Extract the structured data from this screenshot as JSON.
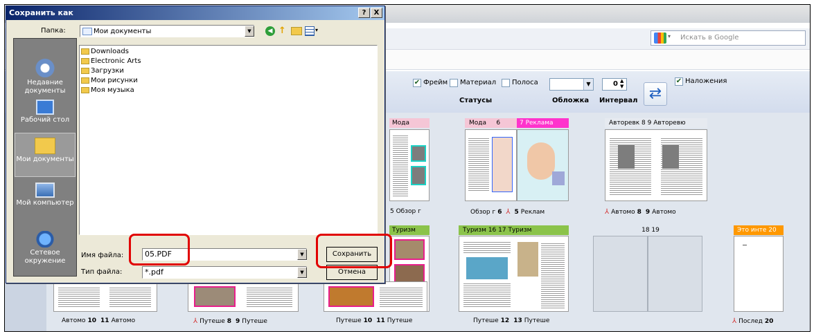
{
  "browser": {
    "search_placeholder": "Искать в Google"
  },
  "toolbar": {
    "frame_label": "Фрейм",
    "material_label": "Материал",
    "strip_label": "Полоса",
    "statuses_label": "Статусы",
    "cover_label": "Обложка",
    "interval_label": "Интервал",
    "interval_value": "0",
    "overlays_label": "Наложения"
  },
  "sections_row1": [
    {
      "name": "Мода",
      "color": "#f5c6d6"
    },
    {
      "name": "Мода",
      "num": "6",
      "color": "#f5c6d6"
    },
    {
      "name": "7 Реклама",
      "color": "#ff33cc"
    },
    {
      "name": "Авторевк 8 9 Авторевю",
      "color": "#e6eaf0"
    }
  ],
  "captions_row1": [
    {
      "text": "5 Обзор г"
    },
    {
      "left_text": "Обзор г",
      "left_num": "6",
      "right_num": "5",
      "right_text": "Реклам"
    },
    {
      "left_text": "Автомо",
      "left_num": "8",
      "right_num": "9",
      "right_text": "Автомо"
    }
  ],
  "sections_row2": [
    {
      "name": "Туризм",
      "color": "#8bc34a"
    },
    {
      "name": "Туризм 16 17 Туризм",
      "color": "#8bc34a"
    },
    {
      "name": "18 19",
      "color": "#e0e6ee"
    },
    {
      "name": "Это инте 20",
      "color": "#ff9800"
    }
  ],
  "captions_row2": [
    {
      "left_text": "Автомо",
      "left_num": "10",
      "right_num": "11",
      "right_text": "Автомо"
    },
    {
      "left_text": "Путеше",
      "left_num": "8",
      "right_num": "9",
      "right_text": "Путеше"
    },
    {
      "left_text": "Путеше",
      "left_num": "10",
      "right_num": "11",
      "right_text": "Путеше"
    },
    {
      "left_text": "Путеше",
      "left_num": "12",
      "right_num": "13",
      "right_text": "Путеше"
    },
    {
      "left_text": "Послед",
      "left_num": "20"
    }
  ],
  "dialog": {
    "title": "Сохранить как",
    "help": "?",
    "close": "X",
    "folder_label": "Папка:",
    "folder_value": "Мои документы",
    "places": [
      "Недавние документы",
      "Рабочий стол",
      "Мои документы",
      "Мой компьютер",
      "Сетевое окружение"
    ],
    "files": [
      "Downloads",
      "Electronic Arts",
      "Загрузки",
      "Мои рисунки",
      "Моя музыка"
    ],
    "filename_label": "Имя файла:",
    "filename_value": "05.PDF",
    "filetype_label": "Тип файла:",
    "filetype_value": "*.pdf",
    "save_button": "Сохранить",
    "cancel_button": "Отмена"
  },
  "colors": {
    "highlight": "#e10000",
    "dialog_title": "#0a246a",
    "toolbar_bg": "#dbe3ef"
  }
}
